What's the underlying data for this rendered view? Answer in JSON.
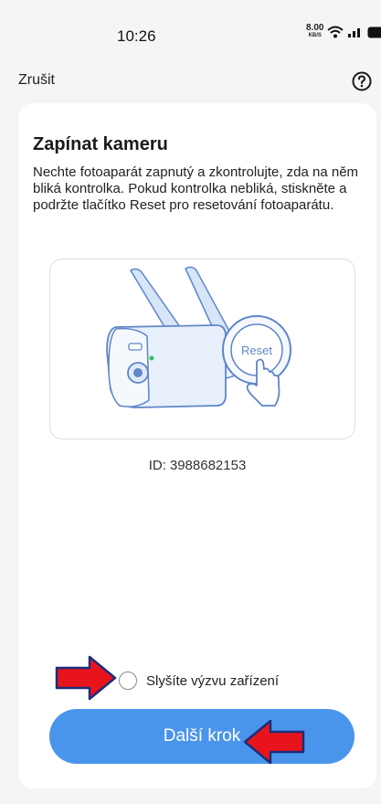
{
  "status_bar": {
    "time": "10:26",
    "net_speed_value": "8.00",
    "net_speed_unit": "KB/S"
  },
  "nav": {
    "cancel_label": "Zrušit",
    "help_icon": "question-circle-icon"
  },
  "card": {
    "title": "Zapínat kameru",
    "description": "Nechte fotoaparát zapnutý a zkontrolujte, zda na něm bliká kontrolka. Pokud kontrolka nebliká, stiskněte a podržte tlačítko Reset pro resetování fotoaparátu.",
    "illustration_button_text": "Reset",
    "device_id_label": "ID:",
    "device_id_value": "3988682153",
    "hear_prompt_label": "Slyšíte výzvu zařízení",
    "next_button_label": "Další krok"
  },
  "colors": {
    "accent": "#4a95ec",
    "annotation_arrow": "#e8141b",
    "annotation_outline": "#1c2d7a"
  }
}
